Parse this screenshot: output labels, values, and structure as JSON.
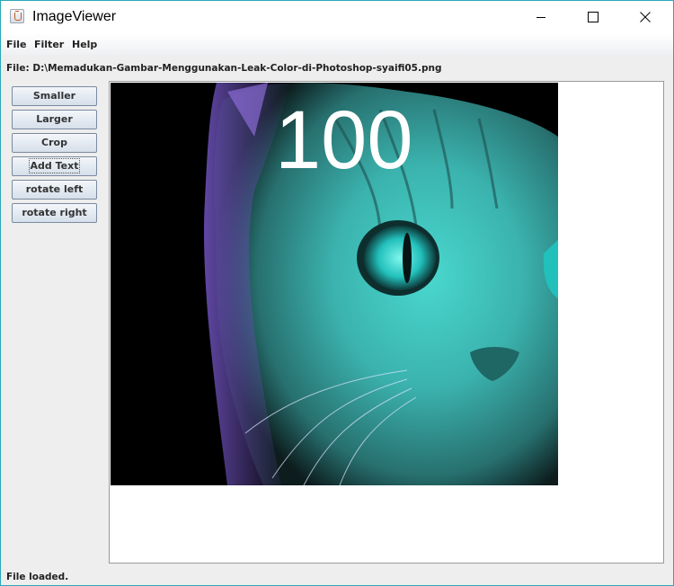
{
  "window": {
    "title": "ImageViewer",
    "accent_border": "#2aa7b8",
    "controls": [
      "minimize-icon",
      "maximize-icon",
      "close-icon"
    ]
  },
  "menu": {
    "items": [
      "File",
      "Filter",
      "Help"
    ]
  },
  "file_label": "File: D:\\Memadukan-Gambar-Menggunakan-Leak-Color-di-Photoshop-syaifi05.png",
  "toolbar": {
    "buttons": [
      "Smaller",
      "Larger",
      "Crop",
      "Add Text",
      "rotate left",
      "rotate right"
    ],
    "focused": "Add Text"
  },
  "image": {
    "overlay_text": "100",
    "overlay_color": "#ffffff",
    "description_colors": [
      "#000000",
      "#47d9cf",
      "#8a6bd6"
    ]
  },
  "status": "File loaded."
}
